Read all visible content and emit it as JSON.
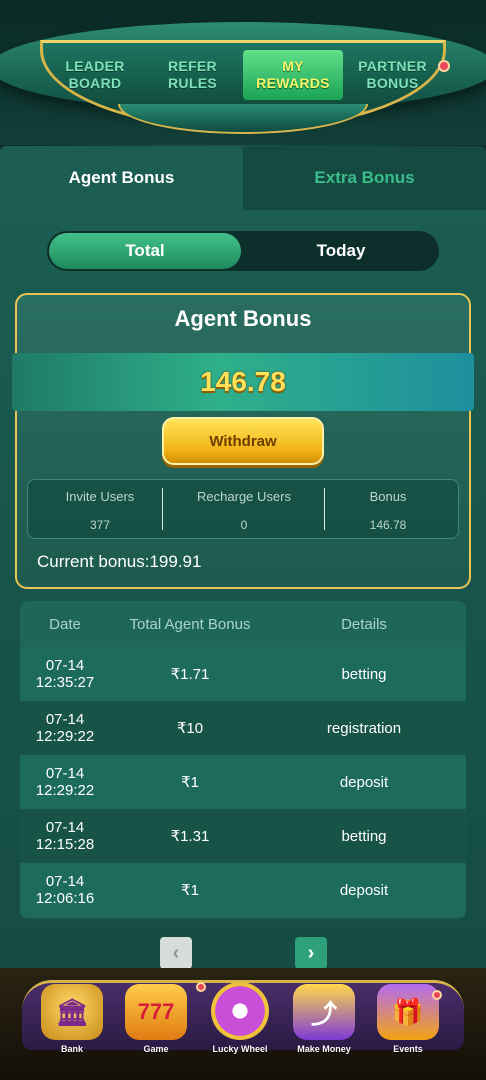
{
  "top_nav": {
    "tabs": [
      {
        "label": "LEADER\nBOARD",
        "active": false
      },
      {
        "label": "REFER\nRULES",
        "active": false
      },
      {
        "label": "MY\nREWARDS",
        "active": true
      },
      {
        "label": "PARTNER\nBONUS",
        "active": false
      }
    ]
  },
  "sub_tabs": {
    "agent_bonus": "Agent Bonus",
    "extra_bonus": "Extra Bonus"
  },
  "toggle": {
    "total": "Total",
    "today": "Today"
  },
  "bonus_card": {
    "title": "Agent Bonus",
    "amount": "146.78",
    "withdraw_label": "Withdraw",
    "stats": [
      {
        "label": "Invite Users",
        "value": "377"
      },
      {
        "label": "Recharge Users",
        "value": "0"
      },
      {
        "label": "Bonus",
        "value": "146.78"
      }
    ],
    "current_bonus": "Current bonus:199.91"
  },
  "table": {
    "headers": [
      "Date",
      "Total Agent Bonus",
      "Details"
    ],
    "rows": [
      {
        "date": "07-14",
        "time": "12:35:27",
        "amount": "₹1.71",
        "details": "betting"
      },
      {
        "date": "07-14",
        "time": "12:29:22",
        "amount": "₹10",
        "details": "registration"
      },
      {
        "date": "07-14",
        "time": "12:29:22",
        "amount": "₹1",
        "details": "deposit"
      },
      {
        "date": "07-14",
        "time": "12:15:28",
        "amount": "₹1.31",
        "details": "betting"
      },
      {
        "date": "07-14",
        "time": "12:06:16",
        "amount": "₹1",
        "details": "deposit"
      }
    ]
  },
  "pager": {
    "prev_icon": "chevron-left-icon",
    "next_icon": "chevron-right-icon"
  },
  "bottom_nav": {
    "items": [
      {
        "label": "Bank",
        "icon": "bank-icon"
      },
      {
        "label": "Game",
        "icon": "slot-777-icon"
      },
      {
        "label": "Lucky Wheel",
        "icon": "wheel-icon"
      },
      {
        "label": "Make Money",
        "icon": "share-money-icon"
      },
      {
        "label": "Events",
        "icon": "gift-icon"
      }
    ]
  },
  "colors": {
    "accent_gold": "#e8c555",
    "amount_yellow": "#ffe25a",
    "active_green": "#43c28b",
    "badge_red": "#e8455b"
  }
}
